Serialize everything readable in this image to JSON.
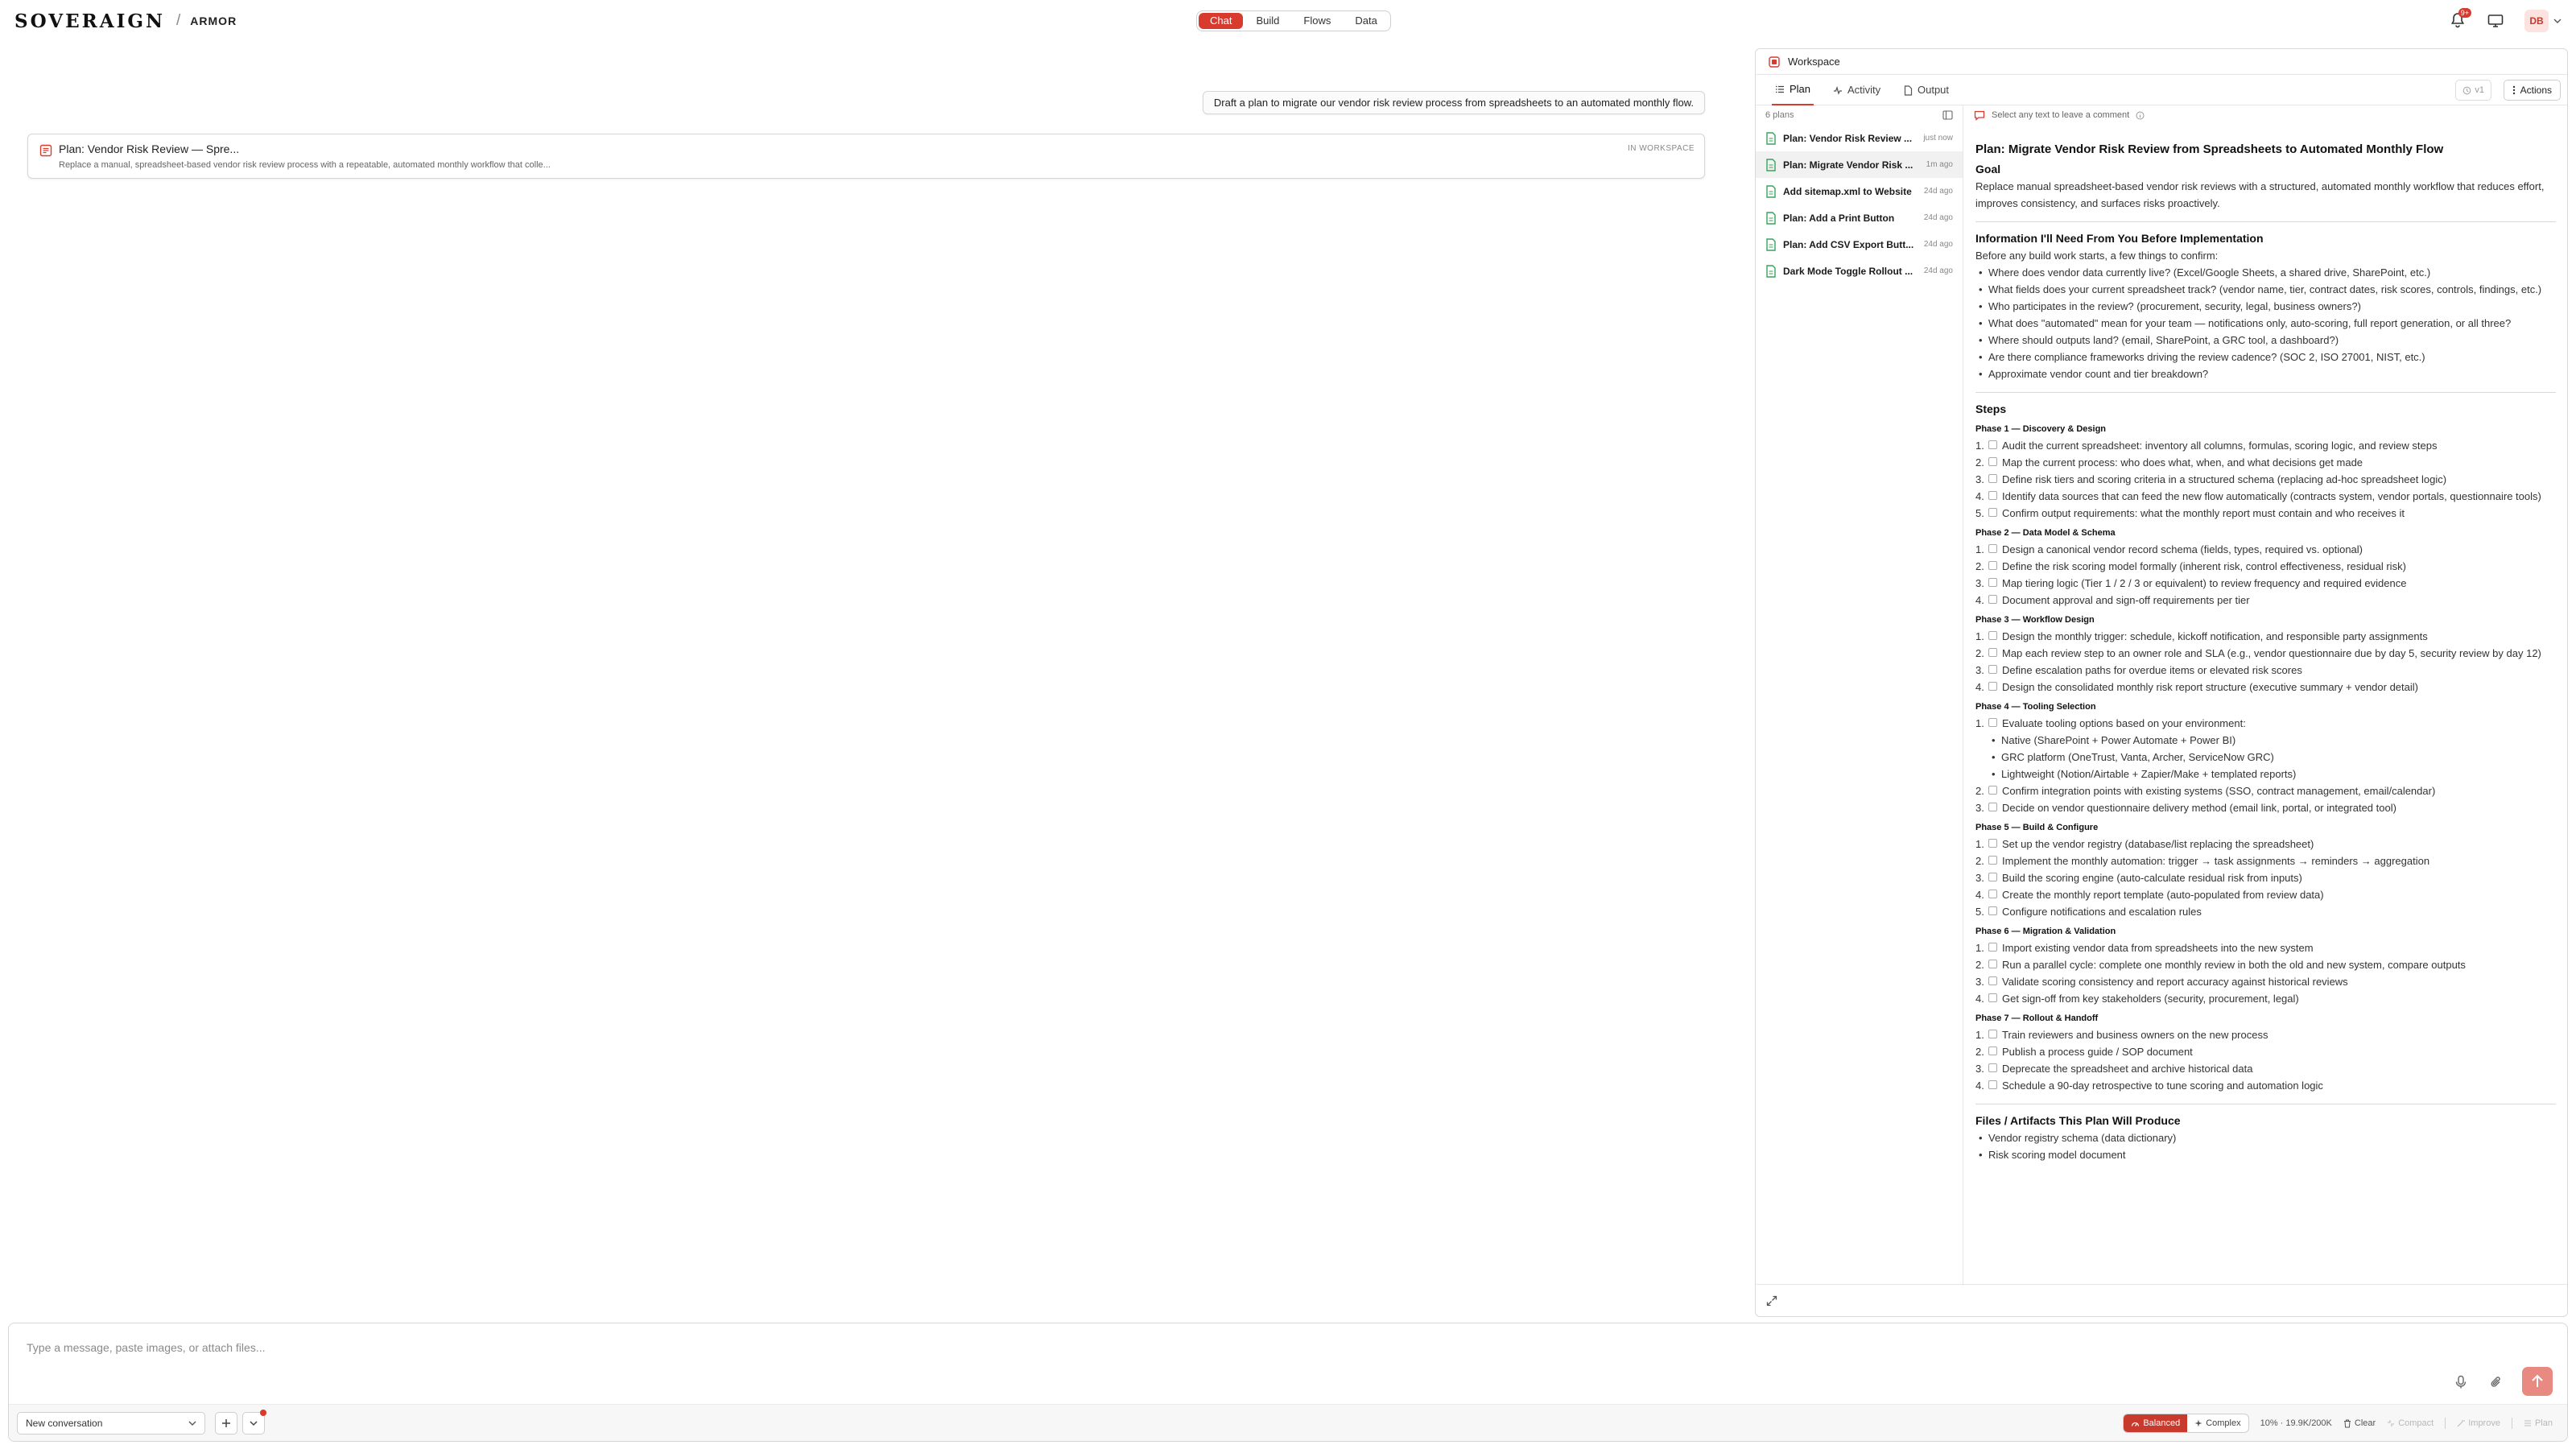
{
  "brand": {
    "logo": "SOVERAIGN",
    "separator": "/",
    "product": "ARMOR"
  },
  "modes": [
    {
      "label": "Chat",
      "active": true
    },
    {
      "label": "Build",
      "active": false
    },
    {
      "label": "Flows",
      "active": false
    },
    {
      "label": "Data",
      "active": false
    }
  ],
  "header": {
    "notification_badge": "9+",
    "avatar_initials": "DB"
  },
  "chat": {
    "user_message": "Draft a plan to migrate our vendor risk review process from spreadsheets to an automated monthly flow.",
    "plan_card": {
      "title": "Plan: Vendor Risk Review — Spre...",
      "description": "Replace a manual, spreadsheet-based vendor risk review process with a repeatable, automated monthly workflow that colle...",
      "status": "IN WORKSPACE"
    }
  },
  "workspace": {
    "title": "Workspace",
    "tabs": [
      {
        "label": "Plan",
        "active": true,
        "icon": "list-icon"
      },
      {
        "label": "Activity",
        "active": false,
        "icon": "activity-icon"
      },
      {
        "label": "Output",
        "active": false,
        "icon": "document-icon"
      }
    ],
    "version": "v1",
    "actions_label": "Actions",
    "plans_count": "6 plans",
    "plans": [
      {
        "title": "Plan: Vendor Risk Review ...",
        "time": "just now",
        "active": false
      },
      {
        "title": "Plan: Migrate Vendor Risk ...",
        "time": "1m ago",
        "active": true
      },
      {
        "title": "Add sitemap.xml to Website",
        "time": "24d ago",
        "active": false
      },
      {
        "title": "Plan: Add a Print Button",
        "time": "24d ago",
        "active": false
      },
      {
        "title": "Plan: Add CSV Export Butt...",
        "time": "24d ago",
        "active": false
      },
      {
        "title": "Dark Mode Toggle Rollout ...",
        "time": "24d ago",
        "active": false
      }
    ],
    "comment_hint": "Select any text to leave a comment",
    "doc": {
      "title": "Plan: Migrate Vendor Risk Review from Spreadsheets to Automated Monthly Flow",
      "goal_heading": "Goal",
      "goal_text": "Replace manual spreadsheet-based vendor risk reviews with a structured, automated monthly workflow that reduces effort, improves consistency, and surfaces risks proactively.",
      "info_heading": "Information I'll Need From You Before Implementation",
      "info_intro": "Before any build work starts, a few things to confirm:",
      "info_items": [
        "Where does vendor data currently live? (Excel/Google Sheets, a shared drive, SharePoint, etc.)",
        "What fields does your current spreadsheet track? (vendor name, tier, contract dates, risk scores, controls, findings, etc.)",
        "Who participates in the review? (procurement, security, legal, business owners?)",
        "What does \"automated\" mean for your team — notifications only, auto-scoring, full report generation, or all three?",
        "Where should outputs land? (email, SharePoint, a GRC tool, a dashboard?)",
        "Are there compliance frameworks driving the review cadence? (SOC 2, ISO 27001, NIST, etc.)",
        "Approximate vendor count and tier breakdown?"
      ],
      "steps_heading": "Steps",
      "phases": [
        {
          "title": "Phase 1 — Discovery & Design",
          "steps": [
            {
              "n": "1.",
              "text": "Audit the current spreadsheet: inventory all columns, formulas, scoring logic, and review steps"
            },
            {
              "n": "2.",
              "text": "Map the current process: who does what, when, and what decisions get made"
            },
            {
              "n": "3.",
              "text": "Define risk tiers and scoring criteria in a structured schema (replacing ad-hoc spreadsheet logic)"
            },
            {
              "n": "4.",
              "text": "Identify data sources that can feed the new flow automatically (contracts system, vendor portals, questionnaire tools)"
            },
            {
              "n": "5.",
              "text": "Confirm output requirements: what the monthly report must contain and who receives it"
            }
          ]
        },
        {
          "title": "Phase 2 — Data Model & Schema",
          "steps": [
            {
              "n": "1.",
              "text": "Design a canonical vendor record schema (fields, types, required vs. optional)"
            },
            {
              "n": "2.",
              "text": "Define the risk scoring model formally (inherent risk, control effectiveness, residual risk)"
            },
            {
              "n": "3.",
              "text": "Map tiering logic (Tier 1 / 2 / 3 or equivalent) to review frequency and required evidence"
            },
            {
              "n": "4.",
              "text": "Document approval and sign-off requirements per tier"
            }
          ]
        },
        {
          "title": "Phase 3 — Workflow Design",
          "steps": [
            {
              "n": "1.",
              "text": "Design the monthly trigger: schedule, kickoff notification, and responsible party assignments"
            },
            {
              "n": "2.",
              "text": "Map each review step to an owner role and SLA (e.g., vendor questionnaire due by day 5, security review by day 12)"
            },
            {
              "n": "3.",
              "text": "Define escalation paths for overdue items or elevated risk scores"
            },
            {
              "n": "4.",
              "text": "Design the consolidated monthly risk report structure (executive summary + vendor detail)"
            }
          ]
        },
        {
          "title": "Phase 4 — Tooling Selection",
          "steps": [
            {
              "n": "1.",
              "text": "Evaluate tooling options based on your environment:",
              "sub": [
                "Native (SharePoint + Power Automate + Power BI)",
                "GRC platform (OneTrust, Vanta, Archer, ServiceNow GRC)",
                "Lightweight (Notion/Airtable + Zapier/Make + templated reports)"
              ]
            },
            {
              "n": "2.",
              "text": "Confirm integration points with existing systems (SSO, contract management, email/calendar)"
            },
            {
              "n": "3.",
              "text": "Decide on vendor questionnaire delivery method (email link, portal, or integrated tool)"
            }
          ]
        },
        {
          "title": "Phase 5 — Build & Configure",
          "steps": [
            {
              "n": "1.",
              "text": "Set up the vendor registry (database/list replacing the spreadsheet)"
            },
            {
              "n": "2.",
              "text": "Implement the monthly automation: trigger → task assignments → reminders → aggregation"
            },
            {
              "n": "3.",
              "text": "Build the scoring engine (auto-calculate residual risk from inputs)"
            },
            {
              "n": "4.",
              "text": "Create the monthly report template (auto-populated from review data)"
            },
            {
              "n": "5.",
              "text": "Configure notifications and escalation rules"
            }
          ]
        },
        {
          "title": "Phase 6 — Migration & Validation",
          "steps": [
            {
              "n": "1.",
              "text": "Import existing vendor data from spreadsheets into the new system"
            },
            {
              "n": "2.",
              "text": "Run a parallel cycle: complete one monthly review in both the old and new system, compare outputs"
            },
            {
              "n": "3.",
              "text": "Validate scoring consistency and report accuracy against historical reviews"
            },
            {
              "n": "4.",
              "text": "Get sign-off from key stakeholders (security, procurement, legal)"
            }
          ]
        },
        {
          "title": "Phase 7 — Rollout & Handoff",
          "steps": [
            {
              "n": "1.",
              "text": "Train reviewers and business owners on the new process"
            },
            {
              "n": "2.",
              "text": "Publish a process guide / SOP document"
            },
            {
              "n": "3.",
              "text": "Deprecate the spreadsheet and archive historical data"
            },
            {
              "n": "4.",
              "text": "Schedule a 90-day retrospective to tune scoring and automation logic"
            }
          ]
        }
      ],
      "artifacts_heading": "Files / Artifacts This Plan Will Produce",
      "artifacts": [
        "Vendor registry schema (data dictionary)",
        "Risk scoring model document"
      ]
    }
  },
  "composer": {
    "placeholder": "Type a message, paste images, or attach files...",
    "conversation": "New conversation",
    "modes": [
      {
        "label": "Balanced",
        "active": true
      },
      {
        "label": "Complex",
        "active": false
      }
    ],
    "usage": "10% · 19.9K/200K",
    "clear": "Clear",
    "compact": "Compact",
    "improve": "Improve",
    "plan": "Plan"
  },
  "colors": {
    "accent": "#d93a2e",
    "send_button": "#e98a82"
  }
}
